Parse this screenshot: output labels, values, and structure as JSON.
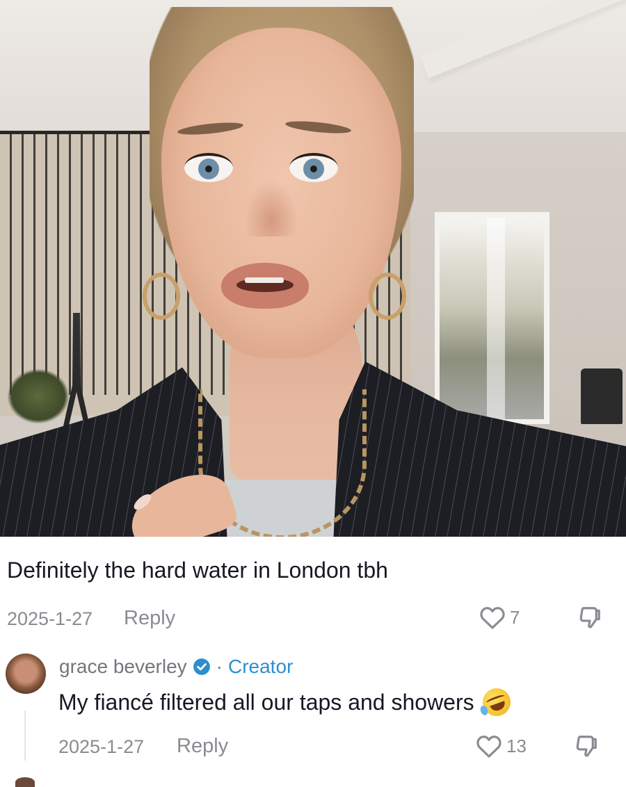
{
  "video": {
    "description_name": "video-frame"
  },
  "comment": {
    "text": "Definitely the hard water in London tbh",
    "date": "2025-1-27",
    "reply_label": "Reply",
    "likes": "7"
  },
  "reply": {
    "username": "grace beverley",
    "separator": "·",
    "badge": "Creator",
    "text": "My fiancé filtered all our taps and showers",
    "emoji": "rolling-on-floor-laughing",
    "date": "2025-1-27",
    "reply_label": "Reply",
    "likes": "13"
  },
  "colors": {
    "text_primary": "#161823",
    "text_muted": "#8a8b91",
    "verified_blue": "#2d8ecf"
  },
  "icons": {
    "like": "heart-outline-icon",
    "dislike": "thumbs-down-outline-icon",
    "verified": "verified-badge-icon"
  }
}
